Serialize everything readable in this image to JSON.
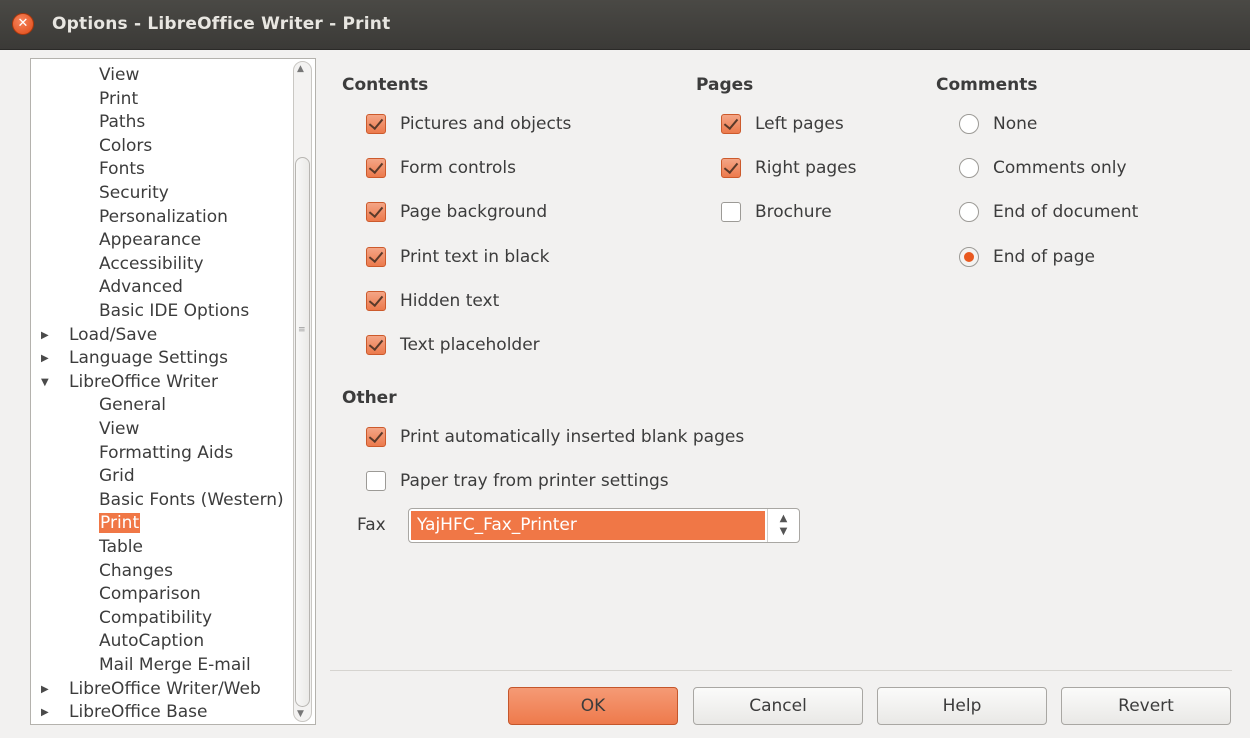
{
  "window": {
    "title": "Options - LibreOffice Writer - Print"
  },
  "tree": {
    "items": [
      {
        "label": "View",
        "level": "child"
      },
      {
        "label": "Print",
        "level": "child"
      },
      {
        "label": "Paths",
        "level": "child"
      },
      {
        "label": "Colors",
        "level": "child"
      },
      {
        "label": "Fonts",
        "level": "child"
      },
      {
        "label": "Security",
        "level": "child"
      },
      {
        "label": "Personalization",
        "level": "child"
      },
      {
        "label": "Appearance",
        "level": "child"
      },
      {
        "label": "Accessibility",
        "level": "child"
      },
      {
        "label": "Advanced",
        "level": "child"
      },
      {
        "label": "Basic IDE Options",
        "level": "child"
      },
      {
        "label": "Load/Save",
        "level": "parent",
        "expander": "collapsed"
      },
      {
        "label": "Language Settings",
        "level": "parent",
        "expander": "collapsed"
      },
      {
        "label": "LibreOffice Writer",
        "level": "parent",
        "expander": "expanded"
      },
      {
        "label": "General",
        "level": "child"
      },
      {
        "label": "View",
        "level": "child"
      },
      {
        "label": "Formatting Aids",
        "level": "child"
      },
      {
        "label": "Grid",
        "level": "child"
      },
      {
        "label": "Basic Fonts (Western)",
        "level": "child"
      },
      {
        "label": "Print",
        "level": "child",
        "selected": true
      },
      {
        "label": "Table",
        "level": "child"
      },
      {
        "label": "Changes",
        "level": "child"
      },
      {
        "label": "Comparison",
        "level": "child"
      },
      {
        "label": "Compatibility",
        "level": "child"
      },
      {
        "label": "AutoCaption",
        "level": "child"
      },
      {
        "label": "Mail Merge E-mail",
        "level": "child"
      },
      {
        "label": "LibreOffice Writer/Web",
        "level": "parent",
        "expander": "collapsed"
      },
      {
        "label": "LibreOffice Base",
        "level": "parent",
        "expander": "collapsed"
      }
    ]
  },
  "contents": {
    "title": "Contents",
    "options": [
      {
        "label": "Pictures and objects",
        "checked": true
      },
      {
        "label": "Form controls",
        "checked": true
      },
      {
        "label": "Page background",
        "checked": true
      },
      {
        "label": "Print text in black",
        "checked": true
      },
      {
        "label": "Hidden text",
        "checked": true
      },
      {
        "label": "Text placeholder",
        "checked": true
      }
    ]
  },
  "pages": {
    "title": "Pages",
    "options": [
      {
        "label": "Left pages",
        "checked": true
      },
      {
        "label": "Right pages",
        "checked": true
      },
      {
        "label": "Brochure",
        "checked": false
      }
    ]
  },
  "comments": {
    "title": "Comments",
    "options": [
      {
        "label": "None",
        "selected": false
      },
      {
        "label": "Comments only",
        "selected": false
      },
      {
        "label": "End of document",
        "selected": false
      },
      {
        "label": "End of page",
        "selected": true
      }
    ]
  },
  "other": {
    "title": "Other",
    "options": [
      {
        "label": "Print automatically inserted blank pages",
        "checked": true
      },
      {
        "label": "Paper tray from printer settings",
        "checked": false
      }
    ],
    "fax_label": "Fax",
    "fax_value": "YajHFC_Fax_Printer"
  },
  "buttons": {
    "ok": "OK",
    "cancel": "Cancel",
    "help": "Help",
    "revert": "Revert"
  },
  "colors": {
    "accent": "#f07746",
    "titlebar": "#3b3a37",
    "background": "#f2f1f0"
  }
}
